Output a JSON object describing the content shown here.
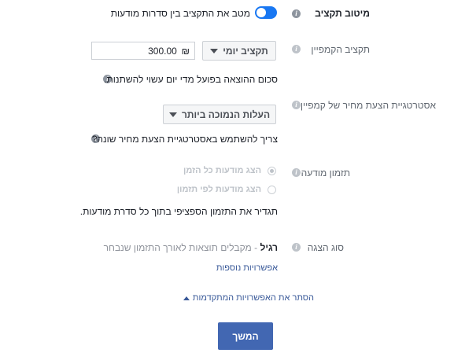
{
  "budget_optimization": {
    "label": "מיטוב תקציב",
    "toggle_text": "מטב את התקציב בין סדרות מודעות",
    "enabled": true
  },
  "campaign_budget": {
    "label": "תקציב הקמפיין",
    "type_button": "תקציב יומי",
    "amount": "300.00",
    "currency": "₪",
    "hint": "סכום ההוצאה בפועל מדי יום עשוי להשתנות."
  },
  "bid_strategy": {
    "label": "אסטרטגיית הצעת מחיר של קמפיין",
    "button": "העלות הנמוכה ביותר",
    "question": "צריך להשתמש באסטרטגיית הצעת מחיר שונה?"
  },
  "ad_scheduling": {
    "label": "תזמון מודעה",
    "options": [
      {
        "label": "הצג מודעות כל הזמן",
        "checked": true
      },
      {
        "label": "הצג מודעות לפי תזמון",
        "checked": false
      }
    ],
    "description": "תגדיר את התזמון הספציפי בתוך כל סדרת מודעות."
  },
  "delivery_type": {
    "label": "סוג הצגה",
    "value_bold": "רגיל",
    "value_rest": " - מקבלים תוצאות לאורך התזמון שנבחר",
    "more_link": "אפשרויות נוספות"
  },
  "hide_advanced_link": "הסתר את האפשרויות המתקדמות",
  "continue_button": "המשך",
  "colors": {
    "accent": "#4267b2",
    "toggle": "#1877f2",
    "link": "#385898"
  }
}
